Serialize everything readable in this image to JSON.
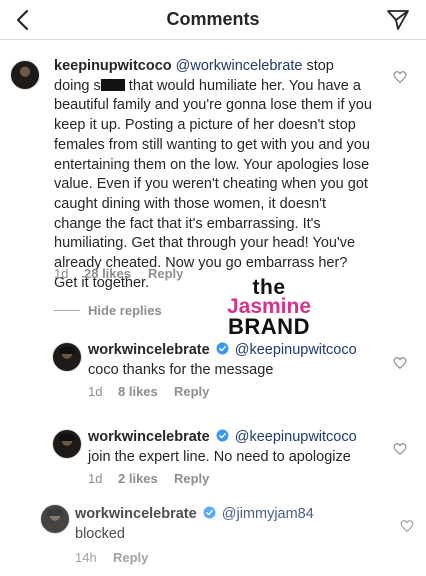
{
  "header": {
    "title": "Comments",
    "back_icon": "chevron-left-icon",
    "share_icon": "paper-plane-icon"
  },
  "comments": [
    {
      "username": "keepinupwitcoco",
      "mention": "@workwincelebrate",
      "text_before_censor": "stop doing s",
      "text_after_censor": "that would humiliate her. You have a beautiful family and you're gonna lose them if you keep it up. Posting a picture of her doesn't stop females from still wanting to get with you and you entertaining them on the low. Your apologies lose value. Even if you weren't cheating when you got caught dining with those women, it doesn't change the fact that it's embarrassing. It's humiliating. Get that through your head! You've already cheated. Now you go embarrass her? Get it together.",
      "time": "1d",
      "likes": "28 likes",
      "reply": "Reply"
    }
  ],
  "hide_replies": "Hide replies",
  "replies": [
    {
      "username": "workwincelebrate",
      "mention": "@keepinupwitcoco",
      "text": "coco thanks for the message",
      "time": "1d",
      "likes": "8 likes",
      "reply": "Reply"
    },
    {
      "username": "workwincelebrate",
      "mention": "@keepinupwitcoco",
      "text": "join the expert line. No need to apologize",
      "time": "1d",
      "likes": "2 likes",
      "reply": "Reply"
    },
    {
      "username": "workwincelebrate",
      "mention": "@jimmyjam84",
      "text": "blocked",
      "time": "14h",
      "likes": "",
      "reply": "Reply"
    }
  ],
  "watermark": {
    "line1": "the",
    "line2": "Jasmine",
    "line3": "BRAND"
  },
  "colors": {
    "mention": "#1f3a6b",
    "meta": "#8e8e8e",
    "verified": "#3897f0",
    "watermark_accent": "#d6338c"
  }
}
